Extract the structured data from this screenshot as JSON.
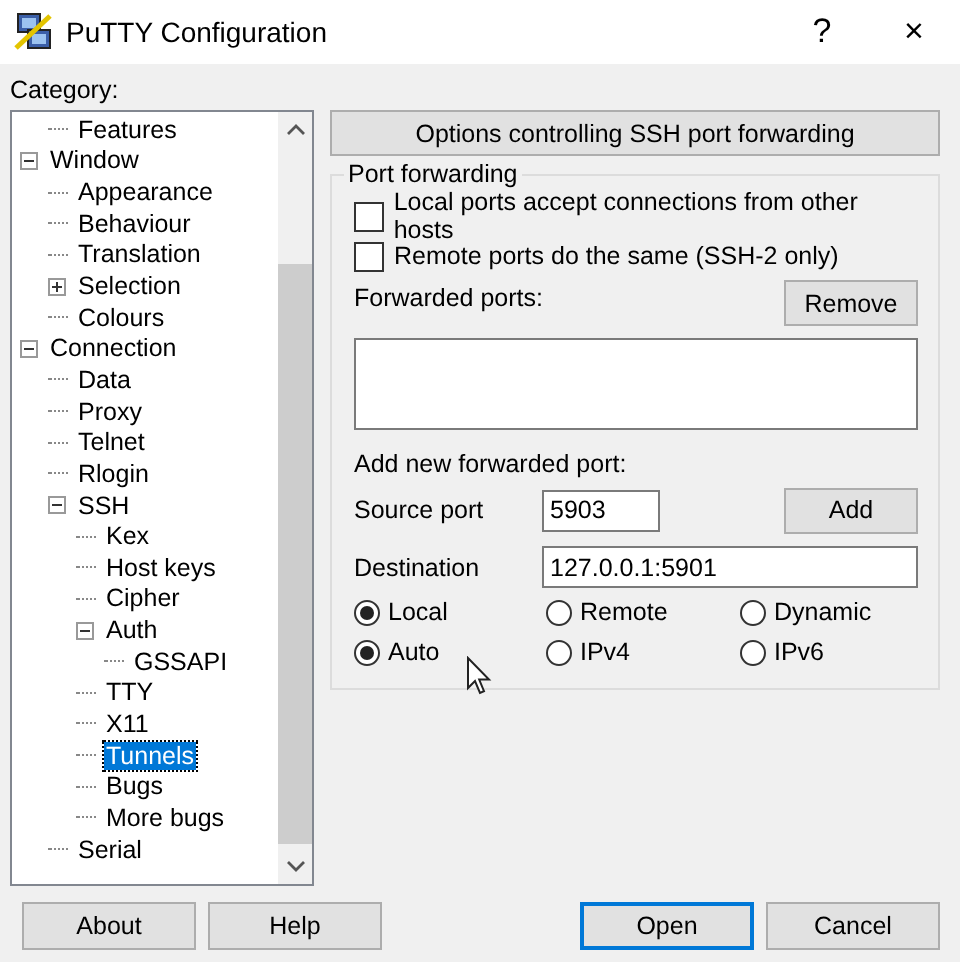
{
  "window": {
    "title": "PuTTY Configuration",
    "controls": [
      "?",
      "×"
    ]
  },
  "category_label": "Category:",
  "tree": {
    "items": [
      {
        "children": [
          {
            "label": "Features",
            "selected": false
          }
        ]
      },
      {
        "label": "Window",
        "selected": false,
        "expanded": true,
        "children": [
          {
            "label": "Appearance",
            "selected": false
          },
          {
            "label": "Behaviour",
            "selected": false
          },
          {
            "label": "Translation",
            "selected": false
          },
          {
            "label": "Selection",
            "selected": false,
            "expanded": false
          },
          {
            "label": "Colours",
            "selected": false
          }
        ]
      },
      {
        "label": "Connection",
        "selected": false,
        "expanded": true,
        "children": [
          {
            "label": "Data",
            "selected": false
          },
          {
            "label": "Proxy",
            "selected": false
          },
          {
            "label": "Telnet",
            "selected": false
          },
          {
            "label": "Rlogin",
            "selected": false
          },
          {
            "label": "SSH",
            "selected": false,
            "expanded": true,
            "children": [
              {
                "label": "Kex",
                "selected": false
              },
              {
                "label": "Host keys",
                "selected": false
              },
              {
                "label": "Cipher",
                "selected": false
              },
              {
                "label": "Auth",
                "selected": false,
                "expanded": true,
                "children": [
                  {
                    "label": "GSSAPI",
                    "selected": false
                  }
                ]
              },
              {
                "label": "TTY",
                "selected": false
              },
              {
                "label": "X11",
                "selected": false
              },
              {
                "label": "Tunnels",
                "selected": true
              },
              {
                "label": "Bugs",
                "selected": false
              },
              {
                "label": "More bugs",
                "selected": false
              }
            ]
          },
          {
            "label": "Serial",
            "selected": false
          }
        ]
      }
    ]
  },
  "panel": {
    "header": "Options controlling SSH port forwarding",
    "group_title": "Port forwarding",
    "checkboxes": [
      {
        "label": "Local ports accept connections from other hosts",
        "checked": false
      },
      {
        "label": "Remote ports do the same (SSH-2 only)",
        "checked": false
      }
    ],
    "forwarded_ports_label": "Forwarded ports:",
    "remove_button": "Remove",
    "add_label": "Add new forwarded port:",
    "source_port": {
      "label": "Source port",
      "value": "5903"
    },
    "add_button": "Add",
    "destination": {
      "label": "Destination",
      "value": "127.0.0.1:5901"
    },
    "radio_rows": [
      [
        {
          "label": "Local",
          "selected": true
        },
        {
          "label": "Remote",
          "selected": false
        },
        {
          "label": "Dynamic",
          "selected": false
        }
      ],
      [
        {
          "label": "Auto",
          "selected": true
        },
        {
          "label": "IPv4",
          "selected": false
        },
        {
          "label": "IPv6",
          "selected": false
        }
      ]
    ]
  },
  "buttons": [
    {
      "label": "About",
      "kind": "plain"
    },
    {
      "label": "Help",
      "kind": "plain"
    },
    {
      "label": "Open",
      "kind": "default"
    },
    {
      "label": "Cancel",
      "kind": "plain"
    }
  ]
}
